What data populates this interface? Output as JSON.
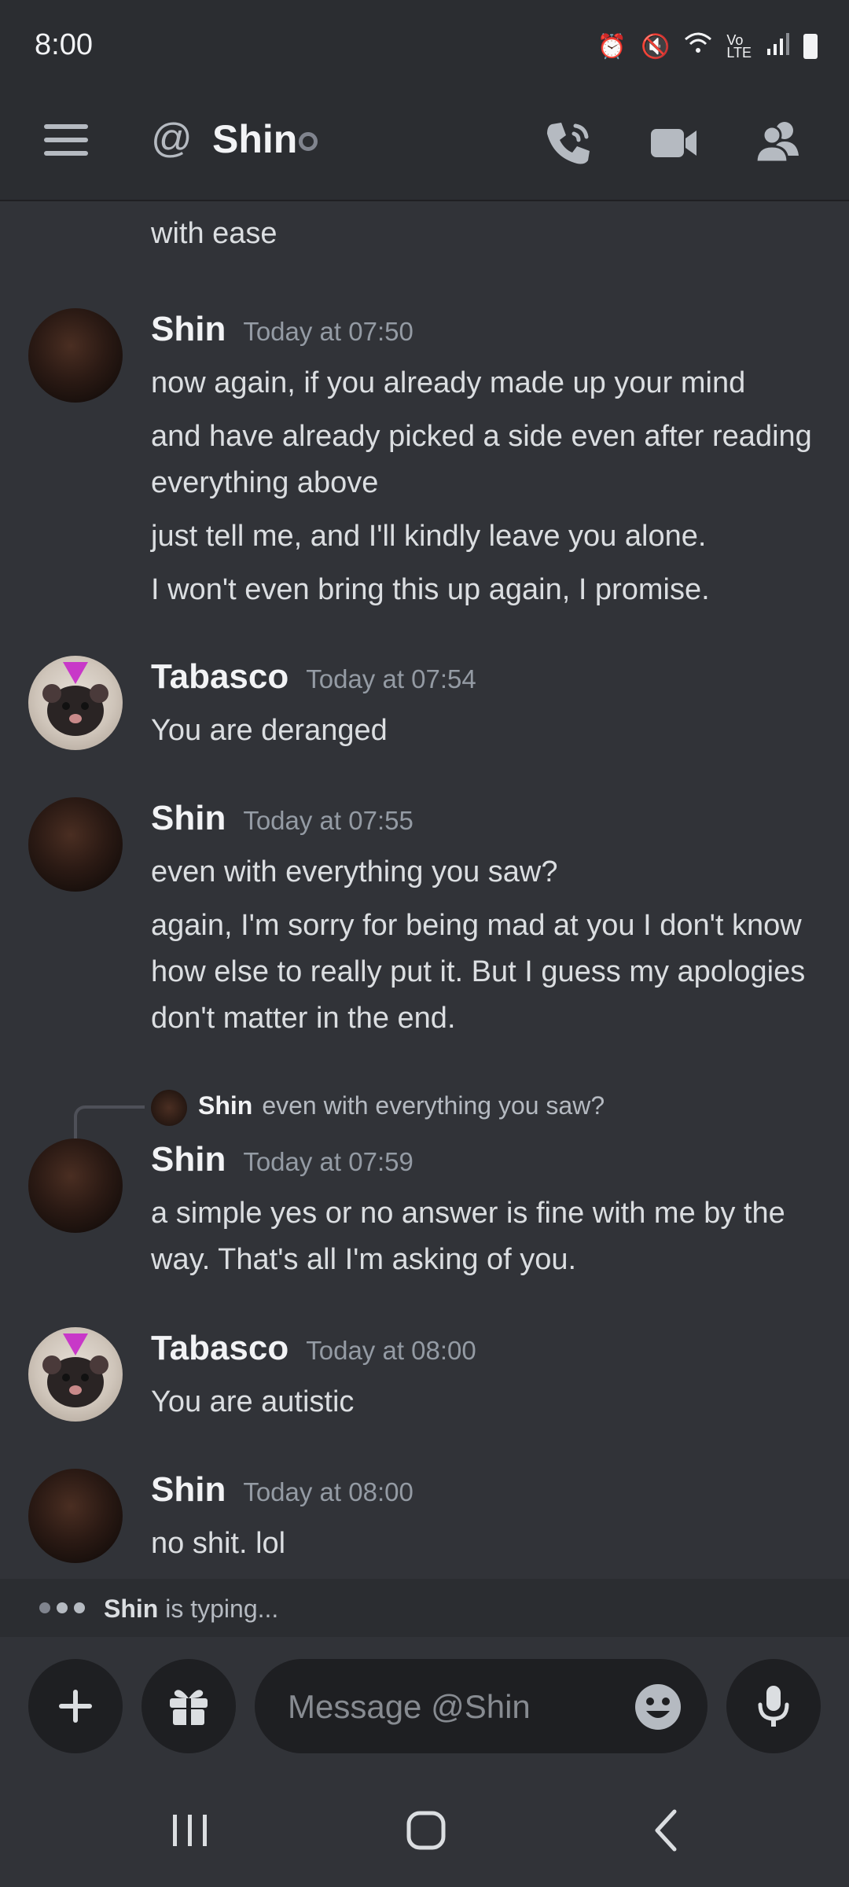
{
  "status_bar": {
    "time": "8:00"
  },
  "header": {
    "title": "Shin"
  },
  "chat": {
    "continuation": "with ease",
    "messages": [
      {
        "author": "Shin",
        "time": "Today at 07:50",
        "lines": [
          "now again, if you already made up your mind",
          "and have already picked a side even after reading everything above",
          "just tell me, and I'll kindly leave you alone.",
          "I won't even bring this up again, I promise."
        ]
      },
      {
        "author": "Tabasco",
        "time": "Today at 07:54",
        "lines": [
          "You are deranged"
        ]
      },
      {
        "author": "Shin",
        "time": "Today at 07:55",
        "lines": [
          "even with everything you saw?",
          "again, I'm sorry for being mad at you I don't know how else to really put it. But I guess my apologies don't matter in the end."
        ]
      },
      {
        "author": "Shin",
        "time": "Today at 07:59",
        "reply_to": {
          "author": "Shin",
          "text": "even with everything you saw?"
        },
        "lines": [
          "a simple yes or no answer is fine with me by the way. That's all I'm asking of you."
        ]
      },
      {
        "author": "Tabasco",
        "time": "Today at 08:00",
        "lines": [
          "You are autistic"
        ]
      },
      {
        "author": "Shin",
        "time": "Today at 08:00",
        "lines": [
          "no shit. lol"
        ]
      }
    ]
  },
  "typing": {
    "user": "Shin",
    "suffix": "is typing..."
  },
  "composer": {
    "placeholder": "Message @Shin"
  },
  "colors": {
    "background": "#313338",
    "header": "#2b2d31",
    "input": "#1e1f22",
    "muted": "#949ba4"
  }
}
